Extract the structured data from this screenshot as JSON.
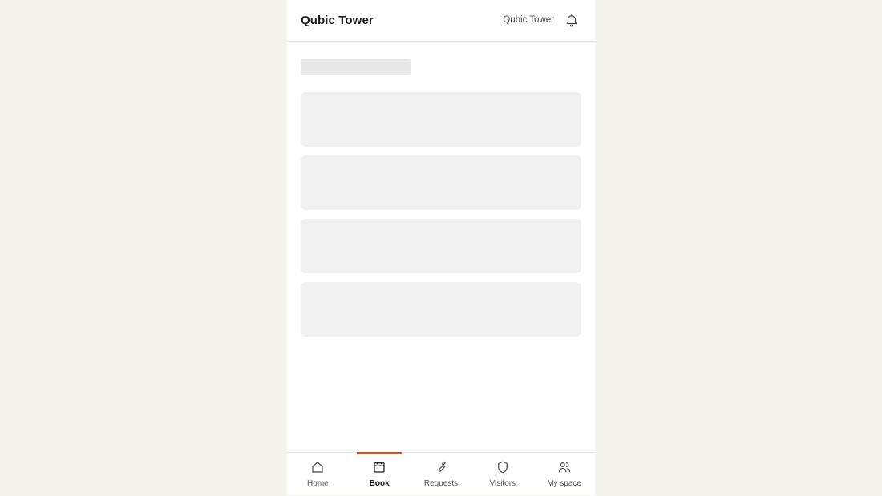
{
  "header": {
    "title": "Qubic Tower",
    "building_name": "Qubic Tower",
    "notification_icon": "bell-icon"
  },
  "content": {
    "state": "loading",
    "skeleton_card_count": 4
  },
  "tabbar": {
    "active_tab": "Book",
    "accent_color": "#c0582e",
    "tabs": [
      {
        "label": "Home",
        "icon": "home-icon"
      },
      {
        "label": "Book",
        "icon": "calendar-icon"
      },
      {
        "label": "Requests",
        "icon": "wrench-icon"
      },
      {
        "label": "Visitors",
        "icon": "shield-icon"
      },
      {
        "label": "My space",
        "icon": "users-icon"
      }
    ]
  }
}
